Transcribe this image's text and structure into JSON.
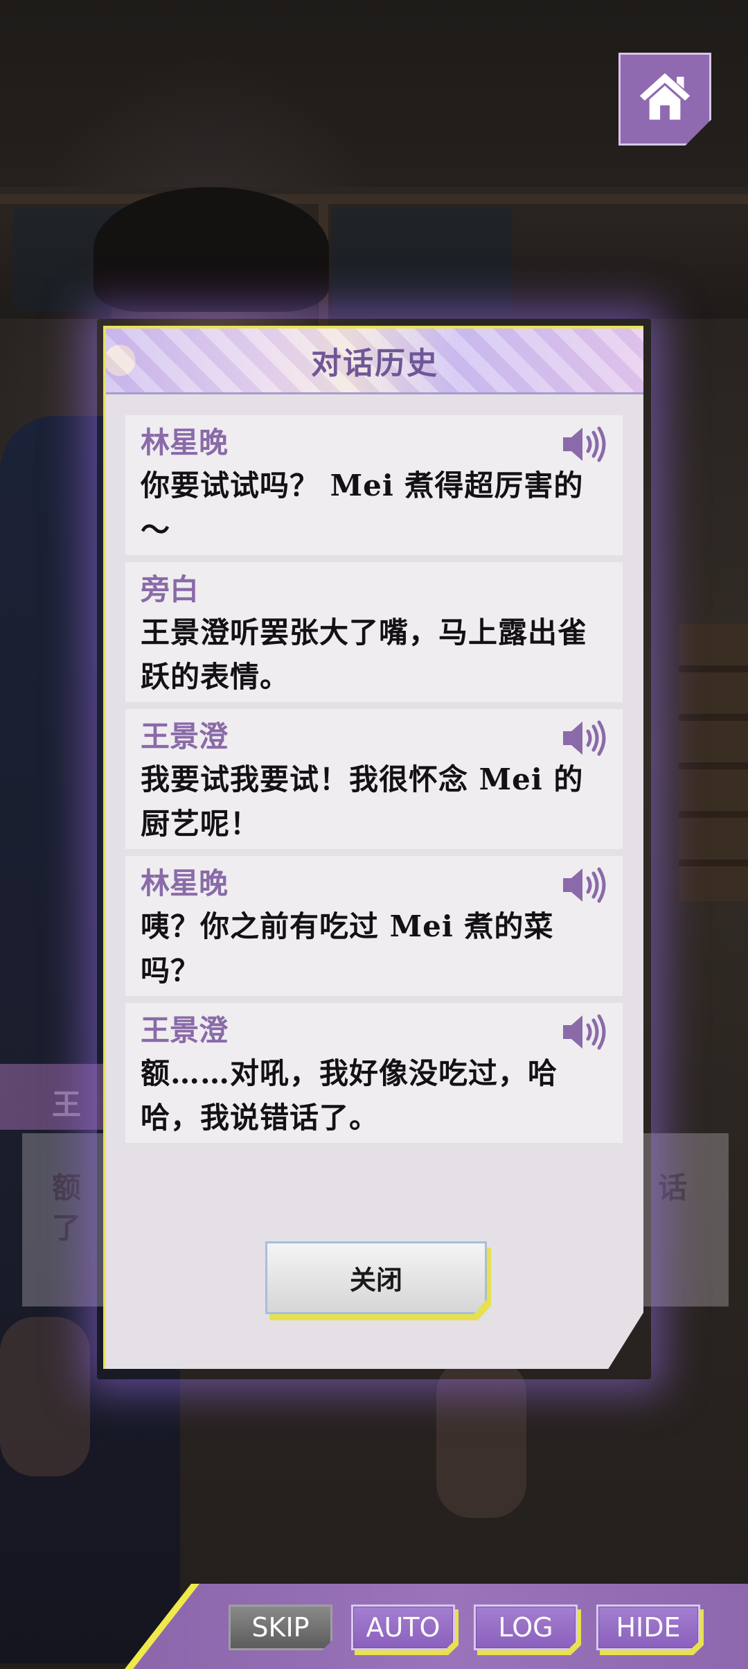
{
  "home": {
    "icon": "home-icon"
  },
  "background": {
    "speaker_name": "王",
    "text_left_line1": "额",
    "text_left_line2": "了",
    "text_right": "话"
  },
  "log": {
    "title": "对话历史",
    "entries": [
      {
        "speaker": "林星晚",
        "text": "你要试试吗？ Mei 煮得超厉害的～",
        "has_voice": true
      },
      {
        "speaker": "旁白",
        "text": "王景澄听罢张大了嘴，马上露出雀跃的表情。",
        "has_voice": false
      },
      {
        "speaker": "王景澄",
        "text": "我要试我要试！我很怀念 Mei 的厨艺呢！",
        "has_voice": true
      },
      {
        "speaker": "林星晚",
        "text": "咦？你之前有吃过 Mei 煮的菜吗？",
        "has_voice": true
      },
      {
        "speaker": "王景澄",
        "text": "额……对吼，我好像没吃过，哈哈，我说错话了。",
        "has_voice": true
      }
    ],
    "close_label": "关闭"
  },
  "toolbar": {
    "skip": "SKIP",
    "auto": "AUTO",
    "log": "LOG",
    "hide": "HIDE"
  },
  "colors": {
    "accent_purple": "#8f6ab0",
    "highlight_yellow": "#e9e25a",
    "speaker_name": "#8a6aa8"
  }
}
